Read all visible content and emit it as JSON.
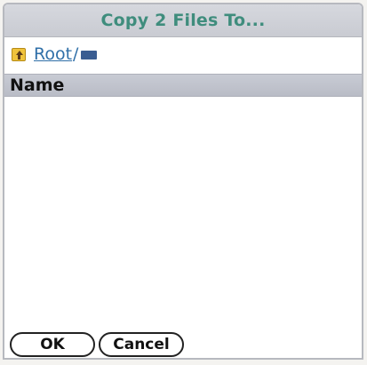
{
  "dialog": {
    "title": "Copy 2 Files To..."
  },
  "path": {
    "up_icon": "folder-up-icon",
    "root_label": "Root",
    "separator": "/",
    "card_icon": "memory-card-icon"
  },
  "list": {
    "column_name": "Name",
    "items": []
  },
  "buttons": {
    "ok_label": "OK",
    "cancel_label": "Cancel"
  },
  "colors": {
    "title_text": "#3f8d7d",
    "link": "#2f6fa8",
    "header_bg": "#c0c3cc"
  }
}
